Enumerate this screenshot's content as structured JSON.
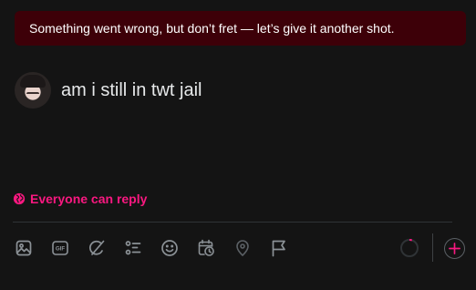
{
  "error_banner": {
    "message": "Something went wrong, but don’t fret — let’s give it another shot."
  },
  "composer": {
    "text": "am i still in twt jail"
  },
  "reply_setting": {
    "label": "Everyone can reply",
    "color": "#f91880"
  },
  "toolbar": {
    "icons": [
      "image-icon",
      "gif-icon",
      "grok-icon",
      "poll-icon",
      "emoji-icon",
      "schedule-icon",
      "location-icon",
      "flag-icon"
    ],
    "gif_label": "GIF"
  },
  "character_progress": {
    "fraction": 0.05
  },
  "colors": {
    "background": "#141414",
    "banner": "#3d0008",
    "accent": "#f91880",
    "icon": "#8b9196"
  }
}
